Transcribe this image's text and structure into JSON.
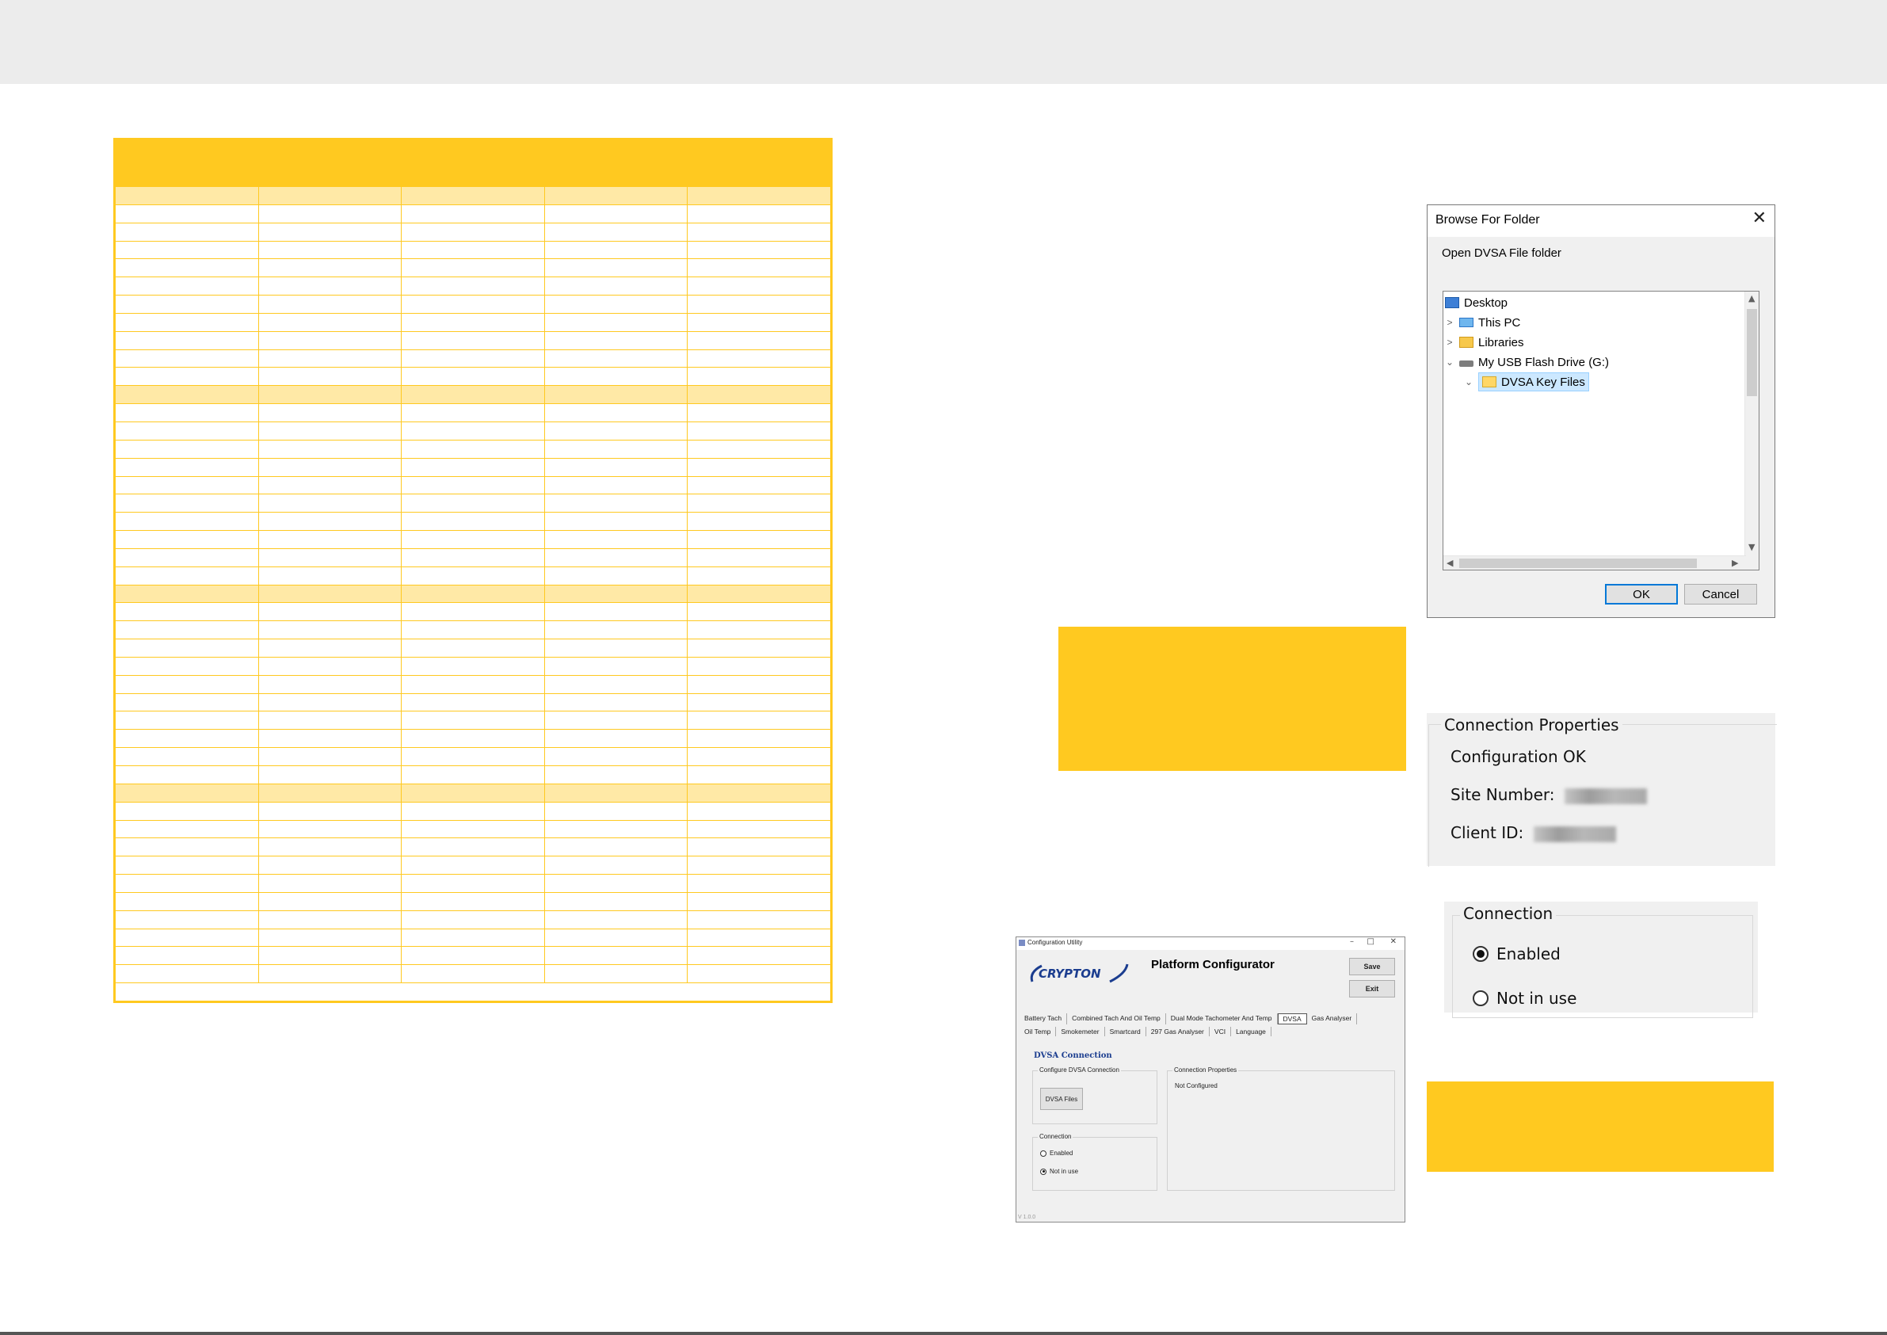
{
  "browse_dialog": {
    "title": "Browse For Folder",
    "close_glyph": "✕",
    "description": "Open DVSA File folder",
    "tree": [
      {
        "label": "Desktop",
        "icon": "desktop-icon",
        "expander": ""
      },
      {
        "label": "This PC",
        "icon": "computer-icon",
        "expander": ">"
      },
      {
        "label": "Libraries",
        "icon": "libraries-icon",
        "expander": ">"
      },
      {
        "label": "My USB Flash Drive (G:)",
        "icon": "usb-drive-icon",
        "expander": "⌄"
      },
      {
        "label": "DVSA Key Files",
        "icon": "folder-icon",
        "expander": "⌄",
        "selected": true
      }
    ],
    "ok_label": "OK",
    "cancel_label": "Cancel"
  },
  "connection_properties": {
    "legend": "Connection Properties",
    "status": "Configuration OK",
    "site_number_label": "Site Number:",
    "client_id_label": "Client ID:"
  },
  "connection": {
    "legend": "Connection",
    "options": [
      {
        "label": "Enabled",
        "selected": true
      },
      {
        "label": "Not in use",
        "selected": false
      }
    ]
  },
  "app": {
    "window_title": "Configuration Utility",
    "logo_text": "CRYPTON",
    "heading": "Platform Configurator",
    "save_label": "Save",
    "exit_label": "Exit",
    "tabs_row1": [
      "Battery Tach",
      "Combined Tach And Oil Temp",
      "Dual Mode Tachometer And Temp",
      "DVSA",
      "Gas Analyser"
    ],
    "tabs_row2": [
      "Oil Temp",
      "Smokemeter",
      "Smartcard",
      "297 Gas Analyser",
      "VCI",
      "Language"
    ],
    "active_tab": "DVSA",
    "section_heading": "DVSA Connection",
    "configure_group": "Configure DVSA Connection",
    "dvsa_files_label": "DVSA Files",
    "connection_group": "Connection",
    "enabled_label": "Enabled",
    "not_in_use_label": "Not in use",
    "props_group": "Connection Properties",
    "props_status": "Not Configured",
    "version": "V 1.0.0"
  },
  "colors": {
    "accent_yellow": "#ffc920",
    "band_yellow": "#ffe9a6",
    "selection_blue": "#cce8ff"
  }
}
